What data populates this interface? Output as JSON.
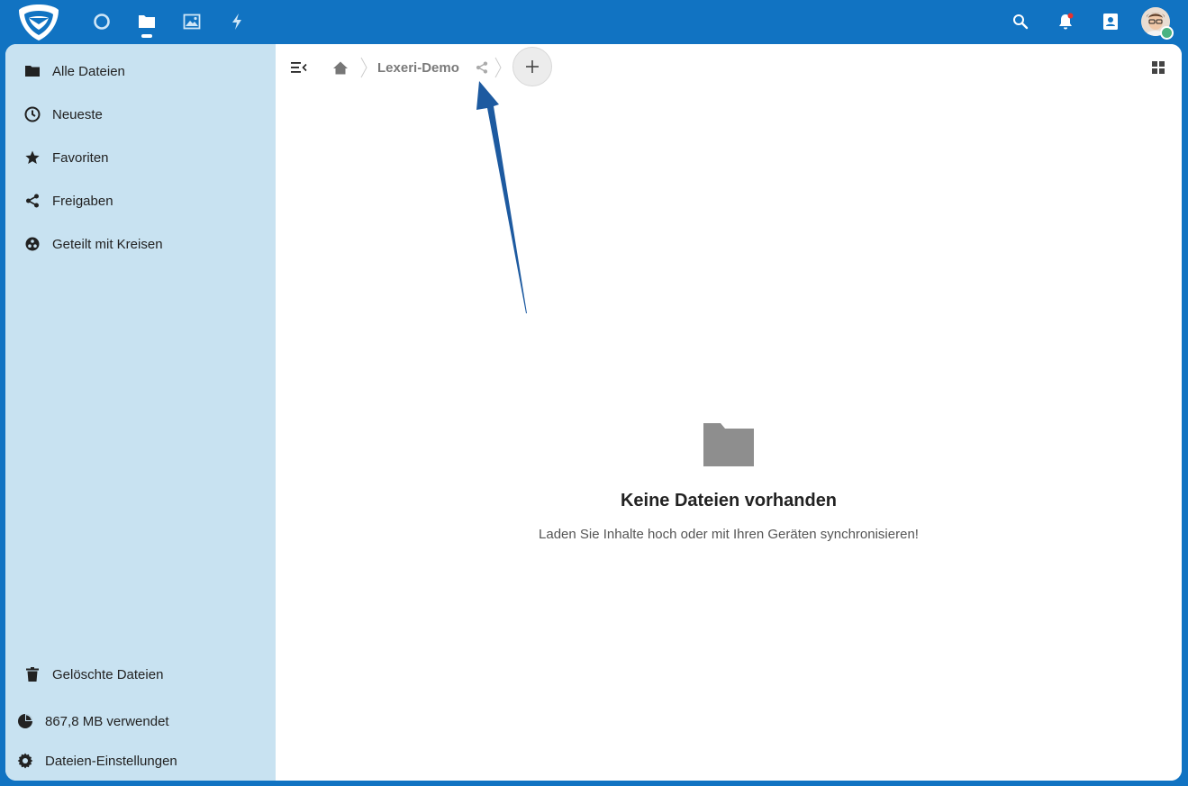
{
  "header": {
    "logo": "shield-logo",
    "apps": [
      {
        "name": "dashboard-icon"
      },
      {
        "name": "files-icon",
        "active": true
      },
      {
        "name": "photos-icon"
      },
      {
        "name": "activity-icon"
      }
    ],
    "right_icons": [
      "search-icon",
      "notifications-icon",
      "contacts-icon"
    ]
  },
  "sidebar": {
    "items": [
      {
        "label": "Alle Dateien",
        "icon": "folder-icon"
      },
      {
        "label": "Neueste",
        "icon": "clock-icon"
      },
      {
        "label": "Favoriten",
        "icon": "star-icon"
      },
      {
        "label": "Freigaben",
        "icon": "share-icon"
      },
      {
        "label": "Geteilt mit Kreisen",
        "icon": "circles-icon"
      }
    ],
    "trash_label": "Gelöschte Dateien",
    "quota_label": "867,8 MB verwendet",
    "settings_label": "Dateien-Einstellungen"
  },
  "breadcrumb": {
    "current": "Lexeri-Demo"
  },
  "empty_state": {
    "title": "Keine Dateien vorhanden",
    "description": "Laden Sie Inhalte hoch oder mit Ihren Geräten synchronisieren!"
  },
  "colors": {
    "header_bg": "#1173c2",
    "sidebar_bg": "#c8e2f1",
    "annotation_arrow": "#1d5aa0"
  }
}
